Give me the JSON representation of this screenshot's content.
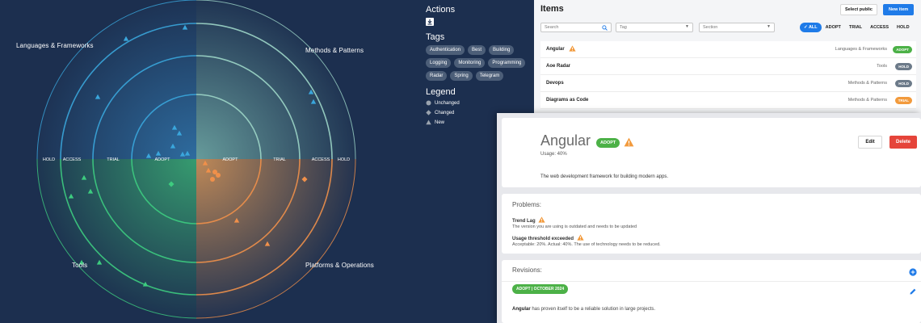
{
  "radar": {
    "quadrants": {
      "top_left": "Languages & Frameworks",
      "top_right": "Methods & Patterns",
      "bottom_left": "Tools",
      "bottom_right": "Platforms & Operations"
    },
    "rings_left": [
      "HOLD",
      "ACCESS",
      "TRIAL",
      "ADOPT"
    ],
    "rings_right": [
      "ADOPT",
      "TRIAL",
      "ACCESS",
      "HOLD"
    ],
    "colors": {
      "background": "#1c2f4f",
      "top_left": "#2f6fa3",
      "top_right": "#7fbfb4",
      "bottom_left": "#3fbf7a",
      "bottom_right": "#e8a05a",
      "blip_blue": "#3aa6dc",
      "blip_green": "#3dcc7f",
      "blip_orange": "#f0904a"
    }
  },
  "actions": {
    "title": "Actions",
    "download_icon": "download-icon"
  },
  "tags": {
    "title": "Tags",
    "items": [
      "Authentication",
      "Best",
      "Building",
      "Logging",
      "Monitoring",
      "Programming",
      "Radar",
      "Spring",
      "Telegram"
    ]
  },
  "legend": {
    "title": "Legend",
    "items": [
      {
        "label": "Unchanged",
        "shape": "circle"
      },
      {
        "label": "Changed",
        "shape": "diamond"
      },
      {
        "label": "New",
        "shape": "triangle"
      }
    ]
  },
  "items_panel": {
    "title": "Items",
    "select_public": "Select public",
    "new_item": "New item",
    "search_placeholder": "Search",
    "tag_placeholder": "Tag",
    "section_placeholder": "Section",
    "ring_filters": [
      "ALL",
      "ADOPT",
      "TRIAL",
      "ACCESS",
      "HOLD"
    ],
    "rows": [
      {
        "name": "Angular",
        "section": "Languages & Frameworks",
        "ring": "ADOPT",
        "warn": true
      },
      {
        "name": "Aoe Radar",
        "section": "Tools",
        "ring": "HOLD",
        "warn": false
      },
      {
        "name": "Devops",
        "section": "Methods & Patterns",
        "ring": "HOLD",
        "warn": false
      },
      {
        "name": "Diagrams as Code",
        "section": "Methods & Patterns",
        "ring": "TRIAL",
        "warn": false
      }
    ],
    "badge_colors": {
      "ADOPT": "#4cb147",
      "HOLD": "#6c7a89",
      "TRIAL": "#f29a3c"
    }
  },
  "detail": {
    "title": "Angular",
    "ring": "ADOPT",
    "usage": "Usage: 40%",
    "description": "The web development framework for building modern apps.",
    "edit_label": "Edit",
    "delete_label": "Delete",
    "problems_title": "Problems:",
    "problems": [
      {
        "name": "Trend Lag",
        "description": "The version you are using is outdated and needs to be updated"
      },
      {
        "name": "Usage threshold exceeded",
        "description": "Acceptable: 20%. Actual: 40%. The use of technology needs to be reduced."
      }
    ],
    "revisions_title": "Revisions:",
    "revision_badge": "ADOPT | OCTOBER 2024",
    "revision_name": "Angular",
    "revision_text": " has proven itself to be a reliable solution in large projects."
  }
}
